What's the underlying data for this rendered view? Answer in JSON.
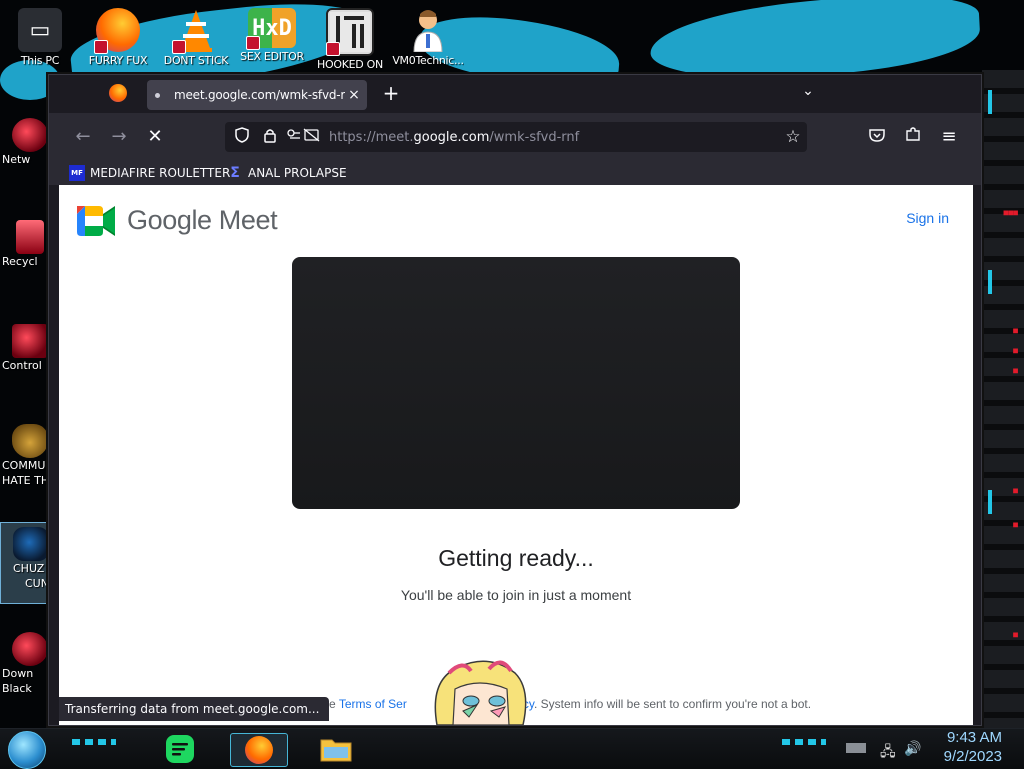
{
  "desktop": {
    "top_icons": [
      {
        "label": "This PC",
        "icon": "pc-icon"
      },
      {
        "label": "FURRY FUX",
        "icon": "firefox-icon"
      },
      {
        "label": "DONT STICK",
        "icon": "vlc-icon"
      },
      {
        "label": "SEX EDITOR",
        "icon": "hxd-icon"
      },
      {
        "label": "HOOKED ON",
        "icon": "maze-icon"
      },
      {
        "label": "VM0Technic...",
        "icon": "doctor-icon"
      }
    ],
    "left_icons": [
      {
        "label": "Netw",
        "icon": "network-icon"
      },
      {
        "label": "Recycl",
        "icon": "recycle-bin-icon"
      },
      {
        "label": "Control",
        "icon": "control-panel-icon"
      },
      {
        "label": "COMMU",
        "label2": "HATE TH",
        "icon": "money-bag-icon"
      },
      {
        "label": "CHUZ",
        "label2": "CUN",
        "icon": "character-icon"
      },
      {
        "label": "Down",
        "label2": "Black",
        "icon": "download-icon"
      }
    ]
  },
  "browser": {
    "tab": {
      "title": "meet.google.com/wmk-sfvd-rnf",
      "close": "×"
    },
    "new_tab": "+",
    "tab_list": "⌄",
    "nav": {
      "back": "←",
      "forward": "→",
      "stop": "✕"
    },
    "url": {
      "prefix": "https://meet.",
      "host": "google.com",
      "path": "/wmk-sfvd-rnf"
    },
    "bookmarks": [
      {
        "label": "MEDIAFIRE ROULETTER",
        "icon": "mediafire-icon",
        "color": "#1d2bd1"
      },
      {
        "label": "ANAL PROLAPSE",
        "icon": "sigma-icon",
        "color": "#3a4bd8"
      }
    ]
  },
  "page": {
    "brand": "Google Meet",
    "sign_in": "Sign in",
    "heading": "Getting ready...",
    "subheading": "You'll be able to join in just a moment",
    "legal": {
      "before": "o the ",
      "terms": "Terms of Ser",
      "policy": "olicy",
      "after": ". System info will be sent to confirm you're not a bot."
    },
    "status": "Transferring data from meet.google.com..."
  },
  "taskbar": {
    "apps": [
      {
        "name": "spotify",
        "icon": "spotify-icon"
      },
      {
        "name": "firefox",
        "icon": "firefox-icon",
        "active": true
      },
      {
        "name": "explorer",
        "icon": "folder-icon"
      }
    ],
    "clock": {
      "time": "9:43 AM",
      "date": "9/2/2023"
    }
  },
  "colors": {
    "accent": "#1a73e8",
    "neon": "#23c7e8",
    "browser_bg": "#1c1b22"
  }
}
